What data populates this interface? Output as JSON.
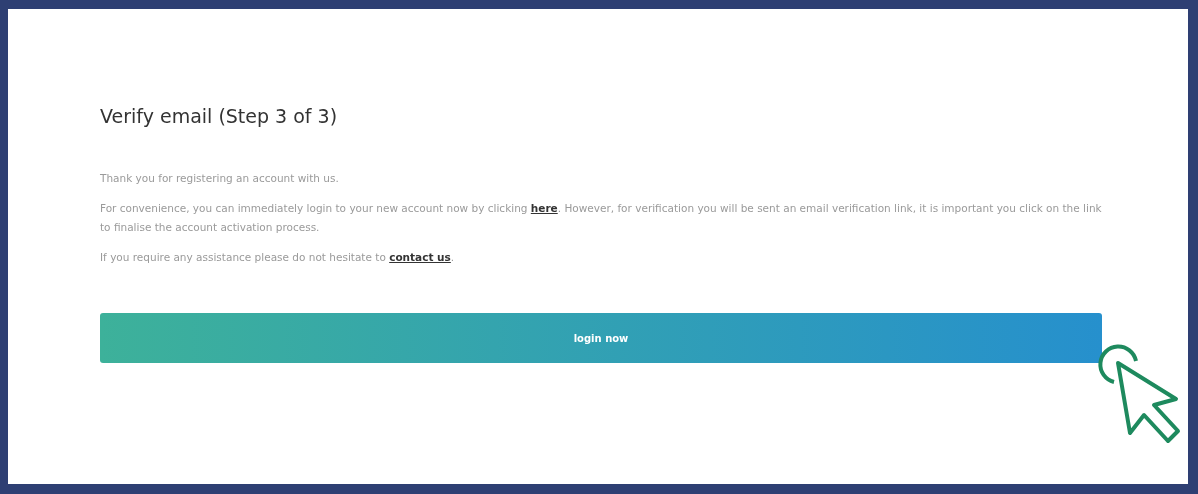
{
  "title": "Verify email (Step 3 of 3)",
  "paragraphs": [
    {
      "before": "Thank you for registering an account with us."
    },
    {
      "before": "For convenience, you can immediately login to your new account now by clicking ",
      "link": "here",
      "after": ". However, for verification you will be sent an email verification link, it is important you click on the link to finalise the account activation process."
    },
    {
      "before": "If you require any assistance please do not hesitate to ",
      "link": "contact us",
      "after": "."
    }
  ],
  "button": {
    "label": "login now"
  }
}
